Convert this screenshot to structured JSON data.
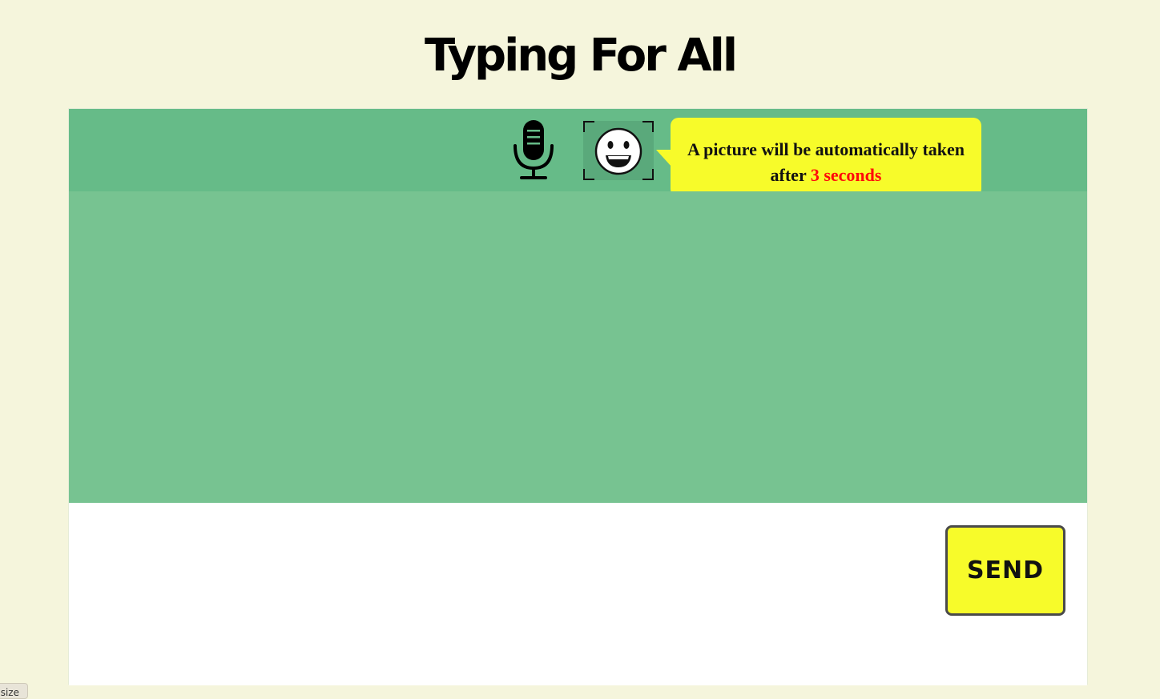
{
  "header": {
    "title": "Typing For All"
  },
  "toolbar": {
    "mic_icon": "microphone-icon",
    "camera_icon": "smiley-face-icon",
    "tooltip": {
      "text_prefix": "A picture will be automatically taken",
      "text_after": "after",
      "countdown": "3 seconds"
    }
  },
  "composer": {
    "send_label": "SEND"
  },
  "corner_tag": {
    "label": "size"
  },
  "colors": {
    "background": "#f5f5dc",
    "toolbar": "#66bb88",
    "chat_area": "#77c391",
    "accent_yellow": "#f7fb2a",
    "countdown_red": "#ff0a0a"
  }
}
